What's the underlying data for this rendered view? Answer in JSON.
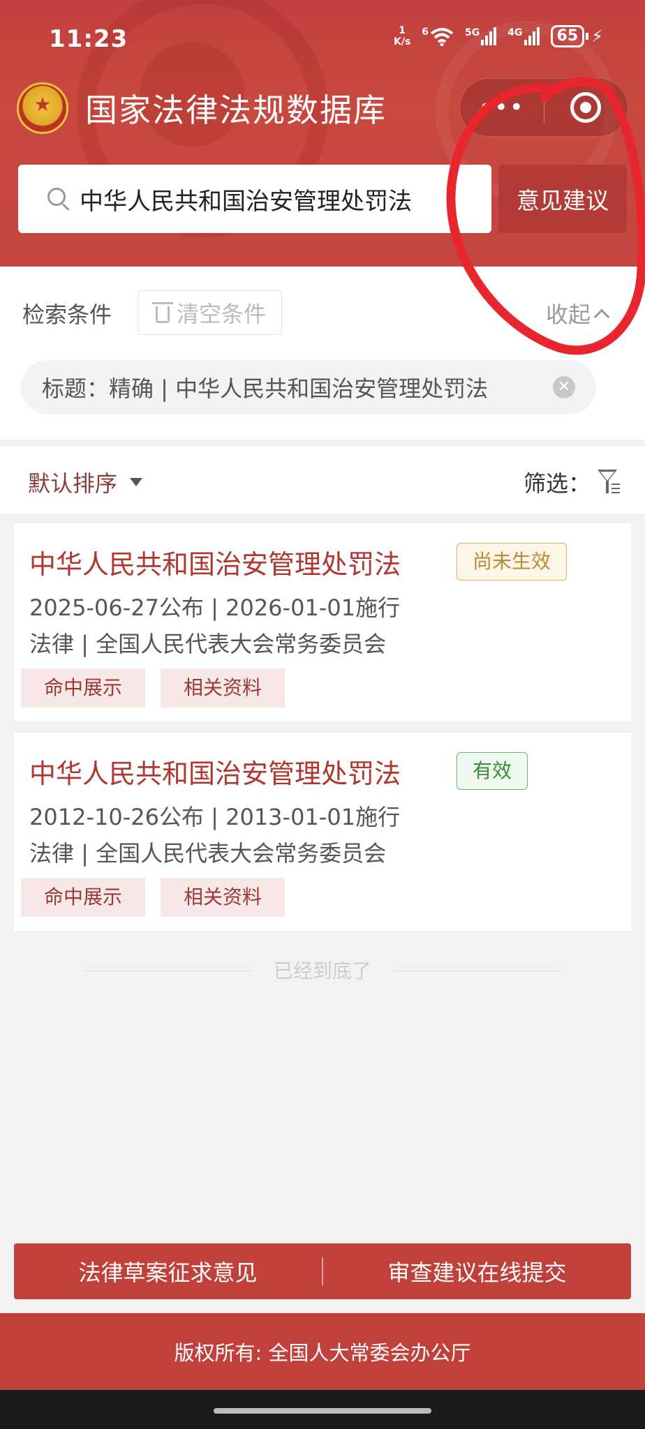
{
  "status_bar": {
    "time": "11:23",
    "net_speed_value": "1",
    "net_speed_unit": "K/s",
    "wifi_label": "6",
    "signal_1_label": "5G",
    "signal_2_label": "4G",
    "battery": "65"
  },
  "app": {
    "title": "国家法律法规数据库",
    "capsule_more": "•••"
  },
  "search": {
    "query": "中华人民共和国治安管理处罚法",
    "feedback_label": "意见建议"
  },
  "conditions": {
    "label": "检索条件",
    "clear_label": "清空条件",
    "collapse_label": "收起",
    "chip_text": "标题：精确 | 中华人民共和国治安管理处罚法"
  },
  "sort_bar": {
    "sort_label": "默认排序",
    "filter_label": "筛选："
  },
  "results": [
    {
      "title": "中华人民共和国治安管理处罚法",
      "status": "尚未生效",
      "dates": "2025-06-27公布 | 2026-01-01施行",
      "category": "法律 | 全国人民代表大会常务委员会",
      "btn_hits": "命中展示",
      "btn_related": "相关资料"
    },
    {
      "title": "中华人民共和国治安管理处罚法",
      "status": "有效",
      "dates": "2012-10-26公布 | 2013-01-01施行",
      "category": "法律 | 全国人民代表大会常务委员会",
      "btn_hits": "命中展示",
      "btn_related": "相关资料"
    }
  ],
  "end_text": "已经到底了",
  "bottom": {
    "left_label": "法律草案征求意见",
    "right_label": "审查建议在线提交"
  },
  "footer": {
    "copyright": "版权所有: 全国人大常委会办公厅"
  },
  "colors": {
    "brand_red": "#c0403c",
    "title_red": "#b0362f",
    "pending_tag": "#b78b3a",
    "valid_tag": "#3a8c3a",
    "annotation_red": "#e8262e"
  }
}
